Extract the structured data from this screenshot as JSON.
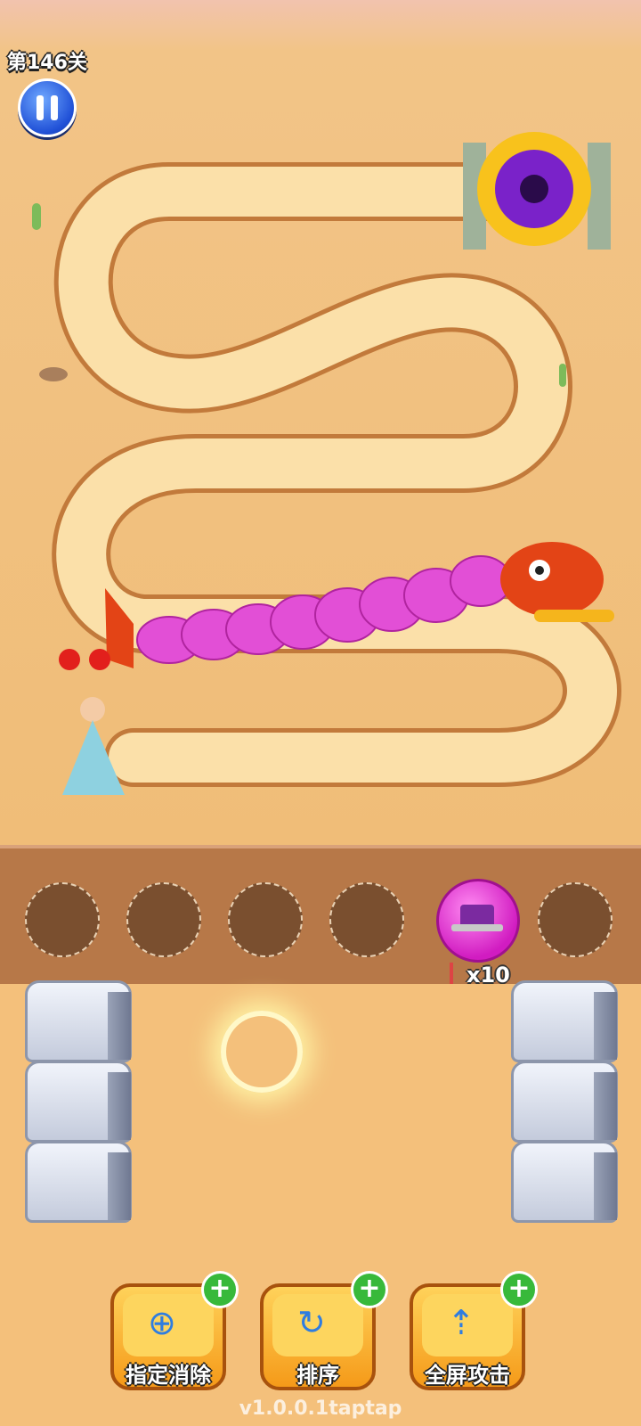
{
  "level": {
    "label": "第146关"
  },
  "lives": {
    "hearts": 2
  },
  "tray": {
    "slots": 6,
    "filled_slot_index": 4,
    "arrow_count": "x10"
  },
  "buttons": [
    {
      "label": "指定消除",
      "icon": "target-tap-icon"
    },
    {
      "label": "排序",
      "icon": "shuffle-hand-icon"
    },
    {
      "label": "全屏攻击",
      "icon": "full-screen-attack-icon"
    }
  ],
  "version": "v1.0.0.1taptap",
  "colors": {
    "sand": "#f0bd78",
    "path": "#fbe0a9",
    "dragon_body": "#e24fd6",
    "dragon_head": "#e34416"
  }
}
